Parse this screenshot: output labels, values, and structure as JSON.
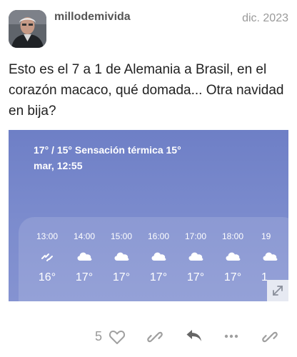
{
  "post": {
    "username": "millodemivida",
    "date": "dic. 2023",
    "text": "Esto es el 7 a 1 de Alemania a Brasil, en el corazón macaco, qué domada... Otra navidad en bija?"
  },
  "weather": {
    "summary": "17° / 15° Sensación térmica 15°",
    "datetime": "mar, 12:55",
    "hourly": [
      {
        "time": "13:00",
        "icon": "rain-icon",
        "temp": "16°"
      },
      {
        "time": "14:00",
        "icon": "cloud-icon",
        "temp": "17°"
      },
      {
        "time": "15:00",
        "icon": "cloud-icon",
        "temp": "17°"
      },
      {
        "time": "16:00",
        "icon": "cloud-icon",
        "temp": "17°"
      },
      {
        "time": "17:00",
        "icon": "cloud-icon",
        "temp": "17°"
      },
      {
        "time": "18:00",
        "icon": "cloud-icon",
        "temp": "17°"
      },
      {
        "time": "19",
        "icon": "cloud-icon",
        "temp": "1"
      }
    ]
  },
  "actions": {
    "like_count": "5",
    "icons": [
      "heart-icon",
      "link-icon",
      "reply-icon",
      "more-icon",
      "link-icon"
    ]
  },
  "colors": {
    "weather_bg": "#7b8bcd",
    "action_icon": "#a0a0a0",
    "reply_icon": "#666666"
  }
}
